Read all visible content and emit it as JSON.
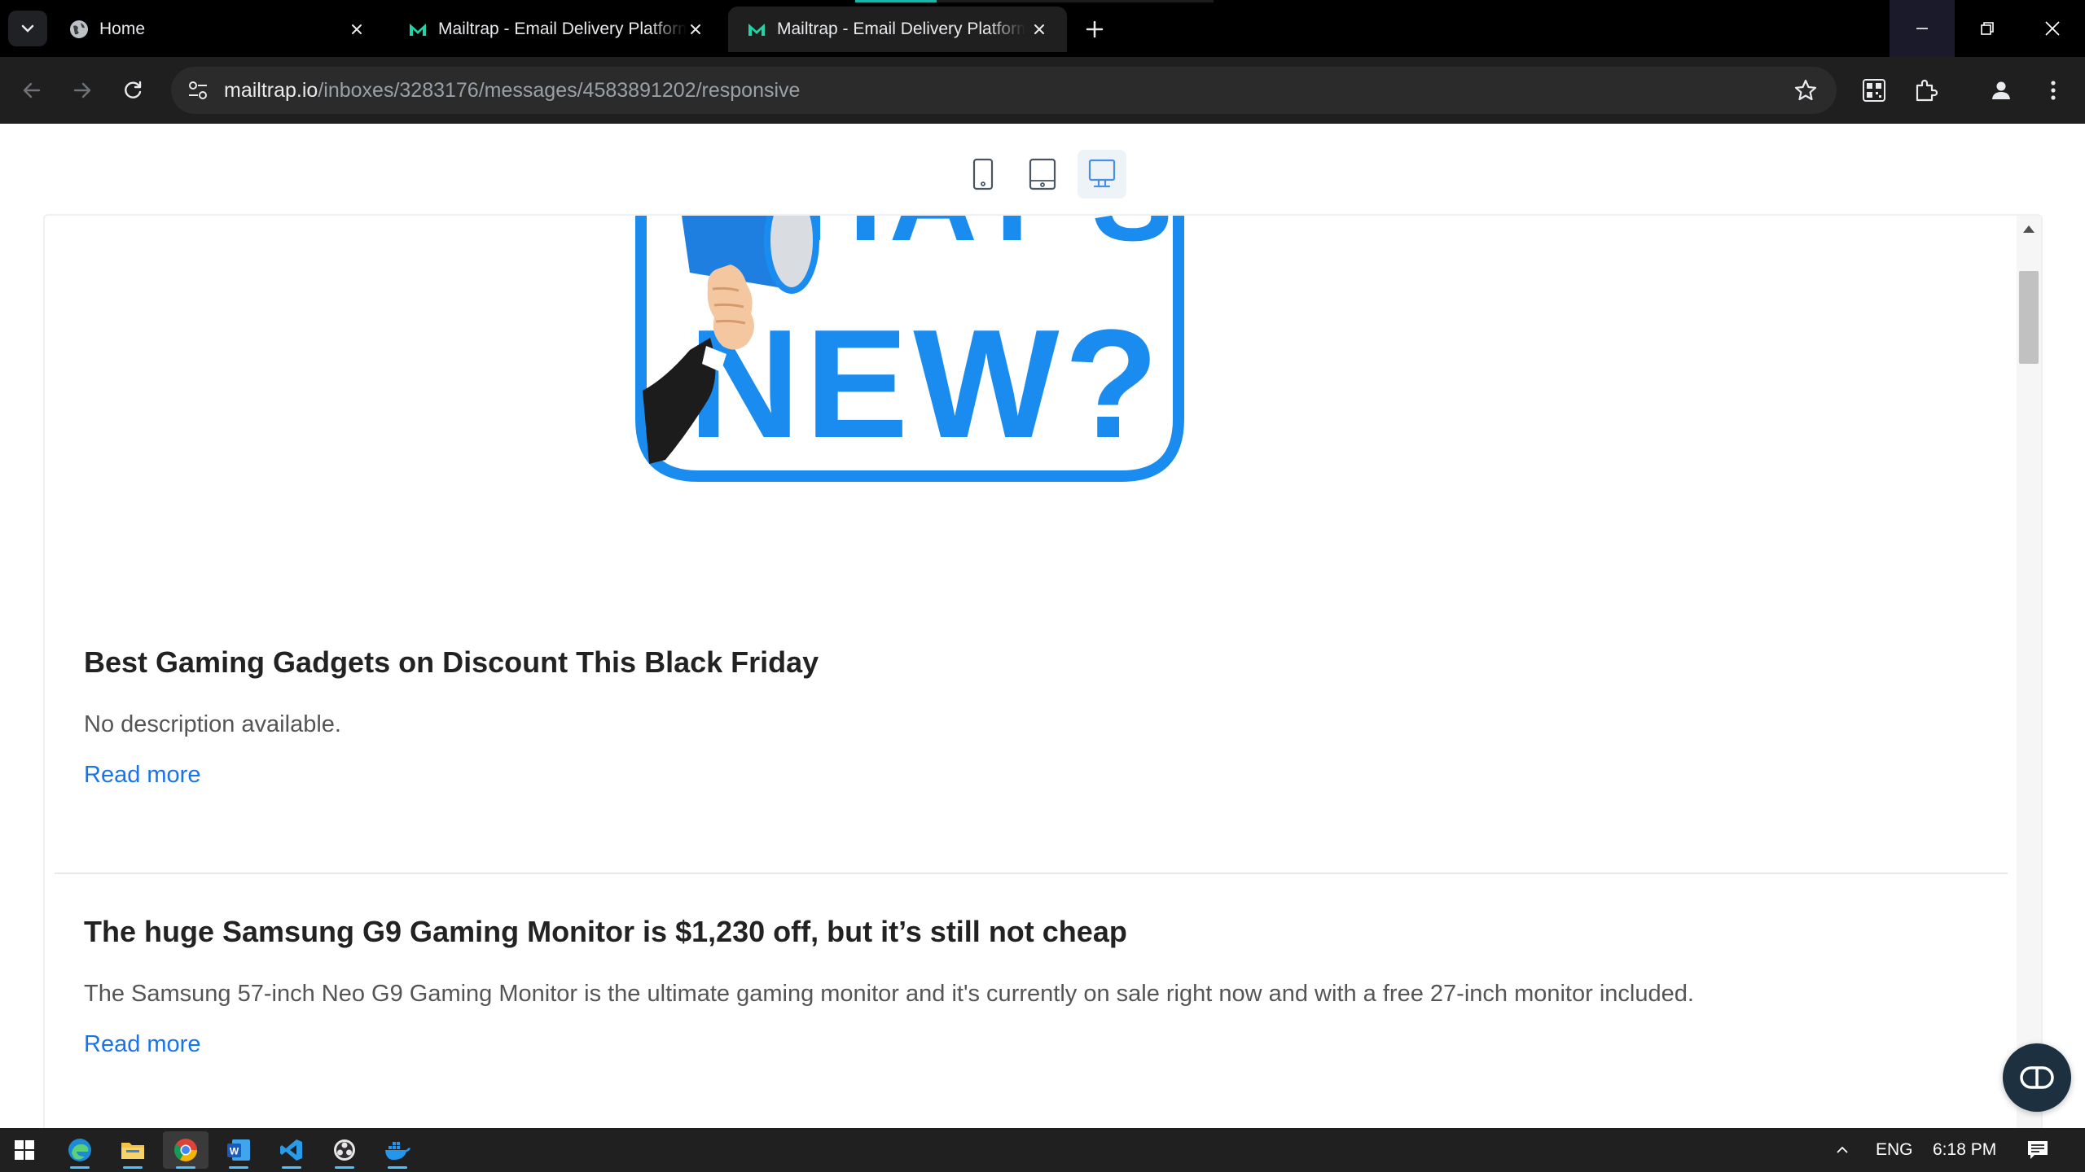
{
  "browser": {
    "tabs": [
      {
        "title": "Home",
        "favicon": "globe-icon",
        "active": false
      },
      {
        "title": "Mailtrap - Email Delivery Platform",
        "favicon": "mailtrap-icon",
        "active": false
      },
      {
        "title": "Mailtrap - Email Delivery Platform",
        "favicon": "mailtrap-icon",
        "active": true
      }
    ],
    "url_host": "mailtrap.io",
    "url_path": "/inboxes/3283176/messages/4583891202/responsive"
  },
  "viewport_switcher": {
    "options": [
      "mobile",
      "tablet",
      "desktop"
    ],
    "selected": "desktop"
  },
  "email": {
    "hero_text": "NEW?",
    "hero_text_top": "WHAT'S",
    "articles": [
      {
        "title": "Best Gaming Gadgets on Discount This Black Friday",
        "description": "No description available.",
        "link_label": "Read more"
      },
      {
        "title": "The huge Samsung G9 Gaming Monitor is $1,230 off, but it’s still not cheap",
        "description": "The Samsung 57-inch Neo G9 Gaming Monitor is the ultimate gaming monitor and it's currently on sale right now and with a free 27-inch monitor included.",
        "link_label": "Read more"
      }
    ]
  },
  "taskbar": {
    "apps": [
      "edge-icon",
      "file-explorer-icon",
      "chrome-icon",
      "word-icon",
      "vscode-icon",
      "obs-icon",
      "docker-icon"
    ],
    "language": "ENG",
    "time": "6:18 PM"
  },
  "colors": {
    "accent_blue": "#1a73e8",
    "hero_blue": "#1a8cf0",
    "mailtrap_green": "#22d3a6"
  }
}
